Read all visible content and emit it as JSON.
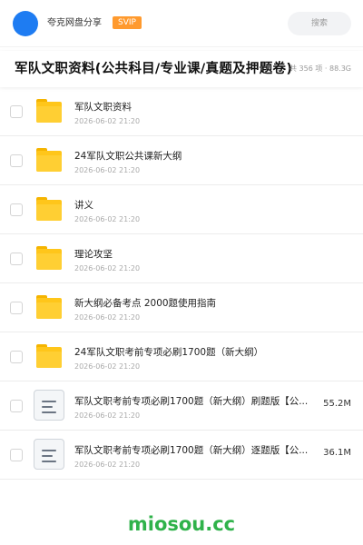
{
  "header": {
    "share_name": "夸克网盘分享",
    "badge": "SVIP",
    "search_label": "搜索"
  },
  "folder": {
    "title": "军队文职资料(公共科目/专业课/真题及押题卷)",
    "meta": "共 356 项 · 88.3G"
  },
  "files": [
    {
      "type": "folder",
      "name": "军队文职资料",
      "date": "2026-06-02 21:20",
      "size": ""
    },
    {
      "type": "folder",
      "name": "24军队文职公共课新大纲",
      "date": "2026-06-02 21:20",
      "size": ""
    },
    {
      "type": "folder",
      "name": "讲义",
      "date": "2026-06-02 21:20",
      "size": ""
    },
    {
      "type": "folder",
      "name": "理论攻坚",
      "date": "2026-06-02 21:20",
      "size": ""
    },
    {
      "type": "folder",
      "name": "新大纲必备考点 2000题使用指南",
      "date": "2026-06-02 21:20",
      "size": ""
    },
    {
      "type": "folder",
      "name": "24军队文职考前专项必刷1700题（新大纲）",
      "date": "2026-06-02 21:20",
      "size": ""
    },
    {
      "type": "document",
      "name": "军队文职考前专项必刷1700题（新大纲）刷题版【公...",
      "date": "2026-06-02 21:20",
      "size": "55.2M"
    },
    {
      "type": "document",
      "name": "军队文职考前专项必刷1700题（新大纲）逐题版【公...",
      "date": "2026-06-02 21:20",
      "size": "36.1M"
    }
  ],
  "watermark": "miosou.cc",
  "colors": {
    "accent": "#1e7cf2",
    "badge": "#ff9a2e",
    "folder": "#ffc61a",
    "watermark": "#2fb24a"
  }
}
